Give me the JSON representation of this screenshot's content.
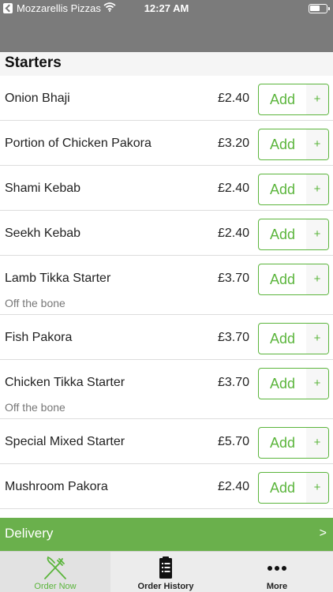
{
  "status_bar": {
    "carrier": "Mozzarellis Pizzas",
    "time": "12:27 AM"
  },
  "section": {
    "title": "Starters"
  },
  "button_labels": {
    "add": "Add",
    "plus": "+"
  },
  "items": [
    {
      "name": "Onion Bhaji",
      "price": "£2.40",
      "description": ""
    },
    {
      "name": "Portion of Chicken Pakora",
      "price": "£3.20",
      "description": ""
    },
    {
      "name": "Shami Kebab",
      "price": "£2.40",
      "description": ""
    },
    {
      "name": "Seekh Kebab",
      "price": "£2.40",
      "description": ""
    },
    {
      "name": "Lamb Tikka Starter",
      "price": "£3.70",
      "description": "Off the bone"
    },
    {
      "name": "Fish Pakora",
      "price": "£3.70",
      "description": ""
    },
    {
      "name": "Chicken Tikka Starter",
      "price": "£3.70",
      "description": "Off the bone"
    },
    {
      "name": "Special Mixed Starter",
      "price": "£5.70",
      "description": ""
    },
    {
      "name": "Mushroom Pakora",
      "price": "£2.40",
      "description": ""
    }
  ],
  "delivery_bar": {
    "label": "Delivery",
    "chevron": ">"
  },
  "tab_bar": {
    "tabs": [
      {
        "label": "Order Now",
        "icon": "fork-knife-icon",
        "active": true
      },
      {
        "label": "Order History",
        "icon": "receipt-list-icon",
        "active": false
      },
      {
        "label": "More",
        "icon": "ellipsis-icon",
        "active": false
      }
    ]
  },
  "colors": {
    "accent_green": "#5bb53c",
    "delivery_green": "#6ab04c",
    "header_gray": "#7b7b7b"
  }
}
